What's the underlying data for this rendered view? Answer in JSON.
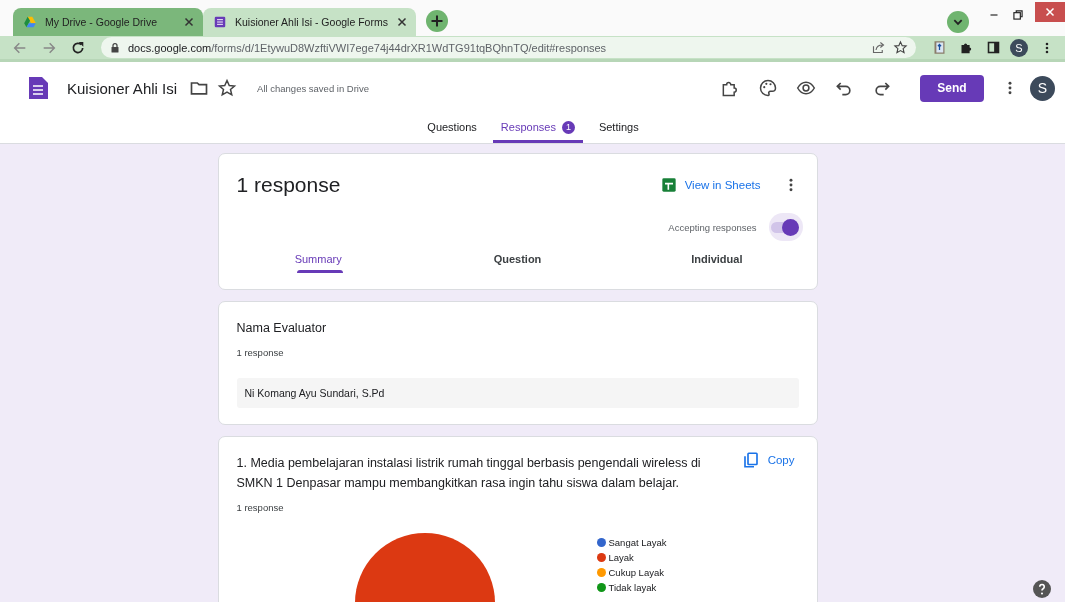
{
  "browser": {
    "tabs": [
      {
        "title": "My Drive - Google Drive",
        "kind": "drive",
        "selected": false
      },
      {
        "title": "Kuisioner Ahli Isi - Google Forms",
        "kind": "forms",
        "selected": true
      }
    ],
    "url": {
      "host": "docs.google.com",
      "path": "/forms/d/1EtywuD8WzftiVWI7ege74j44drXR1WdTG91tqBQhnTQ/edit#responses"
    },
    "profile": "S"
  },
  "app": {
    "title": "Kuisioner Ahli Isi",
    "save_status": "All changes saved in Drive",
    "send": "Send",
    "avatar": "S",
    "tabs": [
      {
        "label": "Questions",
        "selected": false
      },
      {
        "label": "Responses",
        "badge": "1",
        "selected": true
      },
      {
        "label": "Settings",
        "selected": false
      }
    ]
  },
  "summary": {
    "heading": "1 response",
    "sheets_link": "View in Sheets",
    "accepting": {
      "label": "Accepting responses",
      "on": true
    },
    "subtabs": [
      {
        "label": "Summary",
        "selected": true
      },
      {
        "label": "Question",
        "selected": false
      },
      {
        "label": "Individual",
        "selected": false
      }
    ]
  },
  "questions": [
    {
      "kind": "text",
      "title": "Nama Evaluator",
      "count": "1 response",
      "answers": [
        "Ni Komang Ayu Sundari, S.Pd"
      ]
    },
    {
      "kind": "chart",
      "title": "1. Media pembelajaran instalasi listrik rumah tinggal berbasis pengendali wireless di SMKN 1 Denpasar mampu membangkitkan rasa ingin tahu siswa dalam belajar.",
      "count": "1 response",
      "copy": "Copy",
      "chart_data": {
        "type": "pie",
        "categories": [
          "Sangat Layak",
          "Layak",
          "Cukup Layak",
          "Tidak layak"
        ],
        "values": [
          0,
          1,
          0,
          0
        ],
        "colors": [
          "#3366cc",
          "#dc3912",
          "#ff9900",
          "#109618"
        ]
      }
    }
  ]
}
